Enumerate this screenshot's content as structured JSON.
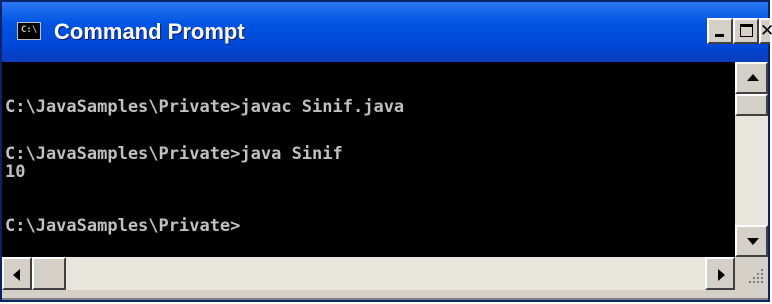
{
  "window": {
    "title": "Command Prompt",
    "icon_label": "C:\\"
  },
  "console": {
    "lines": [
      "C:\\JavaSamples\\Private>javac Sinif.java",
      "",
      "C:\\JavaSamples\\Private>java Sinif",
      "10",
      "",
      "C:\\JavaSamples\\Private>"
    ]
  },
  "colors": {
    "title_bar": "#0054e3",
    "console_bg": "#000000",
    "console_text": "#c0c0c0",
    "frame": "#d4d0c8"
  },
  "icons": {
    "system_menu": "console-icon",
    "minimize": "minimize-icon",
    "maximize": "maximize-icon",
    "close": "close-icon",
    "scroll_up": "arrow-up-icon",
    "scroll_down": "arrow-down-icon",
    "scroll_left": "arrow-left-icon",
    "scroll_right": "arrow-right-icon",
    "size_grip": "resize-grip-icon"
  }
}
